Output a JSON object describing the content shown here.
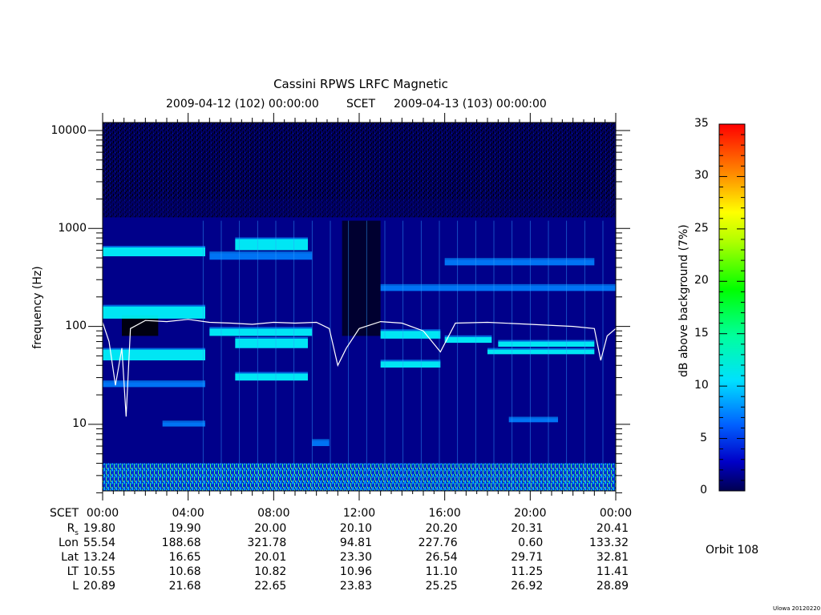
{
  "title": "Cassini RPWS LRFC Magnetic",
  "subtitle": {
    "start": "2009-04-12 (102) 00:00:00",
    "middle": "SCET",
    "end": "2009-04-13 (103) 00:00:00"
  },
  "ylabel": "frequency (Hz)",
  "colorbar_label": "dB above background (7%)",
  "orbit": "Orbit 108",
  "footer_note": "Ulowa 20120220",
  "ephemeris": {
    "labels": [
      "SCET",
      "Rs",
      "Lon",
      "Lat",
      "LT",
      "L"
    ],
    "columns": [
      {
        "SCET": "00:00",
        "Rs": "19.80",
        "Lon": "55.54",
        "Lat": "13.24",
        "LT": "10.55",
        "L": "20.89"
      },
      {
        "SCET": "04:00",
        "Rs": "19.90",
        "Lon": "188.68",
        "Lat": "16.65",
        "LT": "10.68",
        "L": "21.68"
      },
      {
        "SCET": "08:00",
        "Rs": "20.00",
        "Lon": "321.78",
        "Lat": "20.01",
        "LT": "10.82",
        "L": "22.65"
      },
      {
        "SCET": "12:00",
        "Rs": "20.10",
        "Lon": "94.81",
        "Lat": "23.30",
        "LT": "10.96",
        "L": "23.83"
      },
      {
        "SCET": "16:00",
        "Rs": "20.20",
        "Lon": "227.76",
        "Lat": "26.54",
        "LT": "11.10",
        "L": "25.25"
      },
      {
        "SCET": "20:00",
        "Rs": "20.31",
        "Lon": "0.60",
        "Lat": "29.71",
        "LT": "11.25",
        "L": "26.92"
      },
      {
        "SCET": "00:00",
        "Rs": "20.41",
        "Lon": "133.32",
        "Lat": "32.81",
        "LT": "11.41",
        "L": "28.89"
      }
    ]
  },
  "chart_data": {
    "type": "heatmap",
    "title": "Cassini RPWS LRFC Magnetic",
    "xlabel": "SCET",
    "ylabel": "frequency (Hz)",
    "x_tick_labels": [
      "00:00",
      "04:00",
      "08:00",
      "12:00",
      "16:00",
      "20:00",
      "00:00"
    ],
    "x_range_hours": [
      0,
      24
    ],
    "yscale": "log",
    "y_ticks": [
      10,
      100,
      1000,
      10000
    ],
    "ylim": [
      2,
      12000
    ],
    "colorbar": {
      "label": "dB above background (7%)",
      "range": [
        0,
        35
      ],
      "ticks": [
        0,
        5,
        10,
        15,
        20,
        25,
        30,
        35
      ],
      "colors": [
        "#000080",
        "#0000ff",
        "#0080ff",
        "#00ffff",
        "#00ff00",
        "#ffff00",
        "#ff8000",
        "#ff0000"
      ]
    },
    "bands": [
      {
        "t0": 0.0,
        "t1": 4.8,
        "f0": 520,
        "f1": 640,
        "db": 14
      },
      {
        "t0": 0.0,
        "t1": 4.8,
        "f0": 120,
        "f1": 160,
        "db": 16
      },
      {
        "t0": 0.0,
        "t1": 4.8,
        "f0": 45,
        "f1": 58,
        "db": 14
      },
      {
        "t0": 0.0,
        "t1": 4.8,
        "f0": 24,
        "f1": 27,
        "db": 12
      },
      {
        "t0": 2.8,
        "t1": 4.8,
        "f0": 9.5,
        "f1": 10.5,
        "db": 12
      },
      {
        "t0": 5.0,
        "t1": 9.8,
        "f0": 480,
        "f1": 560,
        "db": 10
      },
      {
        "t0": 6.2,
        "t1": 9.6,
        "f0": 600,
        "f1": 780,
        "db": 13
      },
      {
        "t0": 5.0,
        "t1": 9.8,
        "f0": 80,
        "f1": 95,
        "db": 14
      },
      {
        "t0": 6.2,
        "t1": 9.6,
        "f0": 60,
        "f1": 75,
        "db": 14
      },
      {
        "t0": 6.2,
        "t1": 9.6,
        "f0": 28,
        "f1": 33,
        "db": 13
      },
      {
        "t0": 9.8,
        "t1": 10.6,
        "f0": 6,
        "f1": 6.8,
        "db": 10
      },
      {
        "t0": 13.0,
        "t1": 15.8,
        "f0": 75,
        "f1": 90,
        "db": 14
      },
      {
        "t0": 13.0,
        "t1": 15.8,
        "f0": 38,
        "f1": 44,
        "db": 14
      },
      {
        "t0": 16.0,
        "t1": 18.2,
        "f0": 68,
        "f1": 78,
        "db": 13
      },
      {
        "t0": 18.5,
        "t1": 23.0,
        "f0": 62,
        "f1": 70,
        "db": 15
      },
      {
        "t0": 18.0,
        "t1": 23.0,
        "f0": 52,
        "f1": 58,
        "db": 13
      },
      {
        "t0": 19.0,
        "t1": 21.3,
        "f0": 10.5,
        "f1": 11.5,
        "db": 10
      },
      {
        "t0": 16.0,
        "t1": 23.0,
        "f0": 420,
        "f1": 480,
        "db": 9
      },
      {
        "t0": 13.0,
        "t1": 24.0,
        "f0": 230,
        "f1": 260,
        "db": 8
      }
    ],
    "cyclotron_trace_hz": [
      {
        "t": 0.0,
        "f": 110
      },
      {
        "t": 0.3,
        "f": 70
      },
      {
        "t": 0.6,
        "f": 25
      },
      {
        "t": 0.9,
        "f": 60
      },
      {
        "t": 1.1,
        "f": 12
      },
      {
        "t": 1.3,
        "f": 95
      },
      {
        "t": 2.0,
        "f": 115
      },
      {
        "t": 3.0,
        "f": 112
      },
      {
        "t": 4.0,
        "f": 118
      },
      {
        "t": 5.0,
        "f": 110
      },
      {
        "t": 6.0,
        "f": 108
      },
      {
        "t": 7.0,
        "f": 105
      },
      {
        "t": 8.0,
        "f": 110
      },
      {
        "t": 9.0,
        "f": 108
      },
      {
        "t": 10.0,
        "f": 110
      },
      {
        "t": 10.6,
        "f": 95
      },
      {
        "t": 11.0,
        "f": 40
      },
      {
        "t": 11.4,
        "f": 60
      },
      {
        "t": 12.0,
        "f": 95
      },
      {
        "t": 13.0,
        "f": 112
      },
      {
        "t": 14.0,
        "f": 108
      },
      {
        "t": 15.0,
        "f": 90
      },
      {
        "t": 15.8,
        "f": 55
      },
      {
        "t": 16.5,
        "f": 108
      },
      {
        "t": 18.0,
        "f": 110
      },
      {
        "t": 20.0,
        "f": 105
      },
      {
        "t": 22.0,
        "f": 100
      },
      {
        "t": 23.0,
        "f": 95
      },
      {
        "t": 23.3,
        "f": 45
      },
      {
        "t": 23.6,
        "f": 80
      },
      {
        "t": 24.0,
        "f": 95
      }
    ]
  }
}
